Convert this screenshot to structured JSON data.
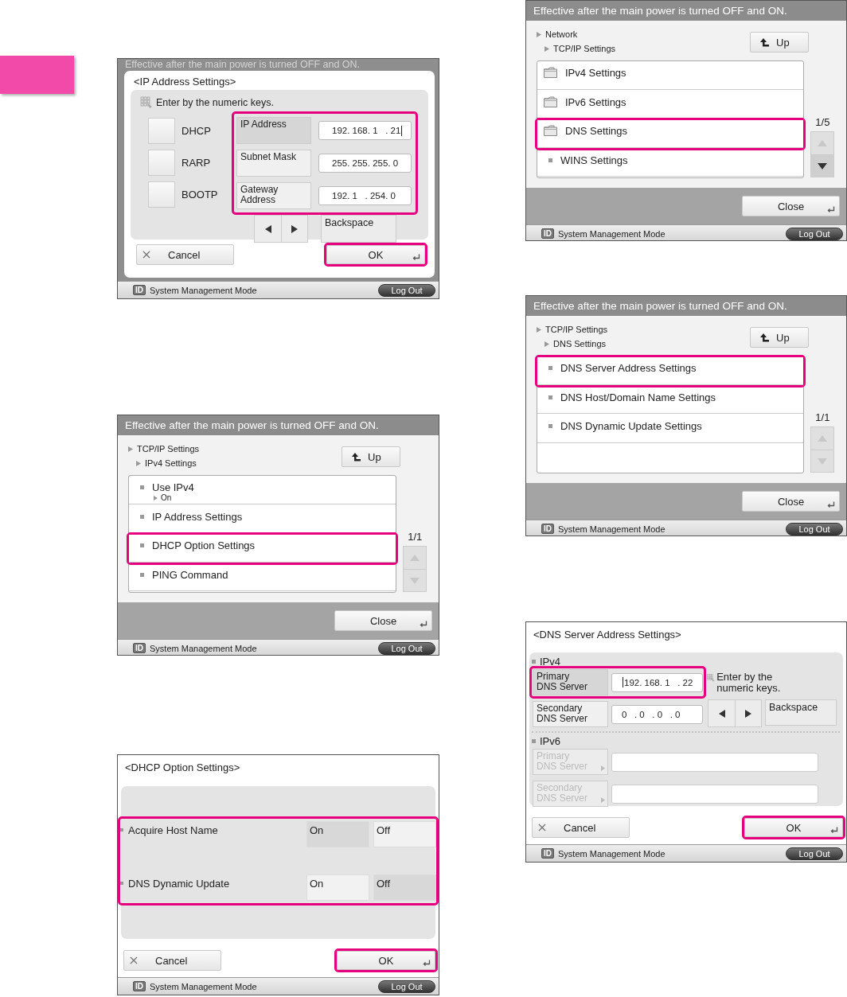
{
  "left_column": [
    {
      "kind": "ip_dialog",
      "notice": "Effective after the main power is turned OFF and ON.",
      "title": "<IP Address Settings>",
      "hint": "Enter by the numeric keys.",
      "methods": [
        {
          "label": "DHCP",
          "checked": false
        },
        {
          "label": "RARP",
          "checked": false
        },
        {
          "label": "BOOTP",
          "checked": false
        }
      ],
      "fields": [
        {
          "label": "IP Address",
          "value": "192. 168. 1   . 21",
          "selected": true,
          "cursor_at_start": false
        },
        {
          "label": "Subnet Mask",
          "value": "255. 255. 255. 0",
          "selected": false
        },
        {
          "label": "Gateway\nAddress",
          "value": "192. 1   . 254. 0",
          "selected": false
        }
      ],
      "fields_highlighted": true,
      "backspace_button": "Backspace",
      "cancel_button": "Cancel",
      "ok_button": "OK",
      "ok_highlighted": true,
      "status_bar": {
        "badge": "ID",
        "mode": "System Management Mode",
        "logout_button": "Log Out"
      }
    },
    {
      "kind": "list",
      "notice": "Effective after the main power is turned OFF and ON.",
      "breadcrumb": {
        "label": "TCP/IP Settings",
        "children": [
          {
            "label": "IPv4 Settings"
          }
        ]
      },
      "up_button": "Up",
      "items": [
        {
          "kind": "setting",
          "label": "Use IPv4",
          "value": "On",
          "highlighted": false
        },
        {
          "kind": "setting",
          "label": "IP Address Settings",
          "highlighted": false
        },
        {
          "kind": "setting",
          "label": "DHCP Option Settings",
          "highlighted": true
        },
        {
          "kind": "setting",
          "label": "PING Command",
          "highlighted": false
        }
      ],
      "page": "1/1",
      "scroll_up_disabled": true,
      "scroll_down_disabled": true,
      "close_button": "Close",
      "status_bar": {
        "badge": "ID",
        "mode": "System Management Mode",
        "logout_button": "Log Out"
      }
    },
    {
      "kind": "toggle_dialog",
      "title": "<DHCP Option Settings>",
      "options": [
        {
          "label": "Acquire Host Name",
          "choices": [
            {
              "label": "On",
              "selected": true
            },
            {
              "label": "Off",
              "selected": false
            }
          ]
        },
        {
          "label": "DNS Dynamic Update",
          "choices": [
            {
              "label": "On",
              "selected": false
            },
            {
              "label": "Off",
              "selected": true
            }
          ]
        }
      ],
      "options_highlighted": true,
      "cancel_button": "Cancel",
      "ok_button": "OK",
      "ok_highlighted": true,
      "status_bar": {
        "badge": "ID",
        "mode": "System Management Mode",
        "logout_button": "Log Out"
      }
    }
  ],
  "right_column": [
    {
      "kind": "list",
      "notice": "Effective after the main power is turned OFF and ON.",
      "breadcrumb": {
        "label": "Network",
        "children": [
          {
            "label": "TCP/IP Settings"
          }
        ]
      },
      "up_button": "Up",
      "items": [
        {
          "kind": "folder",
          "label": "IPv4 Settings",
          "highlighted": false
        },
        {
          "kind": "folder",
          "label": "IPv6 Settings",
          "highlighted": false
        },
        {
          "kind": "folder",
          "label": "DNS Settings",
          "highlighted": true
        },
        {
          "kind": "setting",
          "label": "WINS Settings",
          "highlighted": false
        }
      ],
      "page": "1/5",
      "scroll_up_disabled": true,
      "scroll_down_disabled": false,
      "close_button": "Close",
      "status_bar": {
        "badge": "ID",
        "mode": "System Management Mode",
        "logout_button": "Log Out"
      }
    },
    {
      "kind": "list",
      "notice": "Effective after the main power is turned OFF and ON.",
      "breadcrumb": {
        "label": "TCP/IP Settings",
        "children": [
          {
            "label": "DNS Settings"
          }
        ]
      },
      "up_button": "Up",
      "items": [
        {
          "kind": "setting",
          "label": "DNS Server Address Settings",
          "highlighted": true
        },
        {
          "kind": "setting",
          "label": "DNS Host/Domain Name Settings",
          "highlighted": false
        },
        {
          "kind": "setting",
          "label": "DNS Dynamic Update Settings",
          "highlighted": false
        }
      ],
      "page": "1/1",
      "scroll_up_disabled": true,
      "scroll_down_disabled": true,
      "close_button": "Close",
      "status_bar": {
        "badge": "ID",
        "mode": "System Management Mode",
        "logout_button": "Log Out"
      }
    },
    {
      "kind": "dns_dialog",
      "title": "<DNS Server Address Settings>",
      "hint": "Enter by the numeric keys.",
      "groups": [
        {
          "label": "IPv4",
          "rows": [
            {
              "label": "Primary\nDNS Server",
              "value": "192. 168. 1   . 22",
              "selected": true,
              "cursor_at_start": true,
              "disabled": false,
              "highlighted": true
            },
            {
              "label": "Secondary\nDNS Server",
              "value": "0   . 0   . 0   . 0",
              "selected": false,
              "disabled": false,
              "highlighted": false
            }
          ]
        },
        {
          "label": "IPv6",
          "rows": [
            {
              "label": "Primary\nDNS Server",
              "selected": false,
              "disabled": true,
              "highlighted": false
            },
            {
              "label": "Secondary\nDNS Server",
              "selected": false,
              "disabled": true,
              "highlighted": false
            }
          ]
        }
      ],
      "backspace_button": "Backspace",
      "cancel_button": "Cancel",
      "ok_button": "OK",
      "ok_highlighted": true,
      "status_bar": {
        "badge": "ID",
        "mode": "System Management Mode",
        "logout_button": "Log Out"
      }
    }
  ]
}
